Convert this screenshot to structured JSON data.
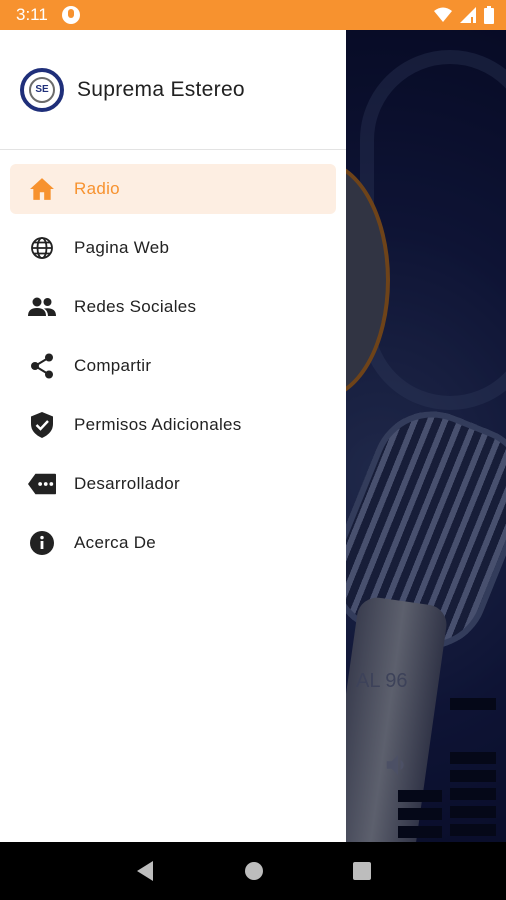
{
  "status_bar": {
    "time": "3:11",
    "background": "#f7922f"
  },
  "drawer": {
    "title": "Suprema Estereo",
    "logo_text": "SE",
    "items": [
      {
        "label": "Radio",
        "icon": "home-icon",
        "active": true
      },
      {
        "label": "Pagina Web",
        "icon": "globe-icon",
        "active": false
      },
      {
        "label": "Redes Sociales",
        "icon": "people-icon",
        "active": false
      },
      {
        "label": "Compartir",
        "icon": "share-icon",
        "active": false
      },
      {
        "label": "Permisos Adicionales",
        "icon": "shield-check-icon",
        "active": false
      },
      {
        "label": "Desarrollador",
        "icon": "label-dots-icon",
        "active": false
      },
      {
        "label": "Acerca De",
        "icon": "info-icon",
        "active": false
      }
    ]
  },
  "background_app": {
    "fm_text": "AL 96"
  },
  "colors": {
    "accent": "#f7922f",
    "active_bg": "#fdeee2",
    "text": "#222222"
  }
}
